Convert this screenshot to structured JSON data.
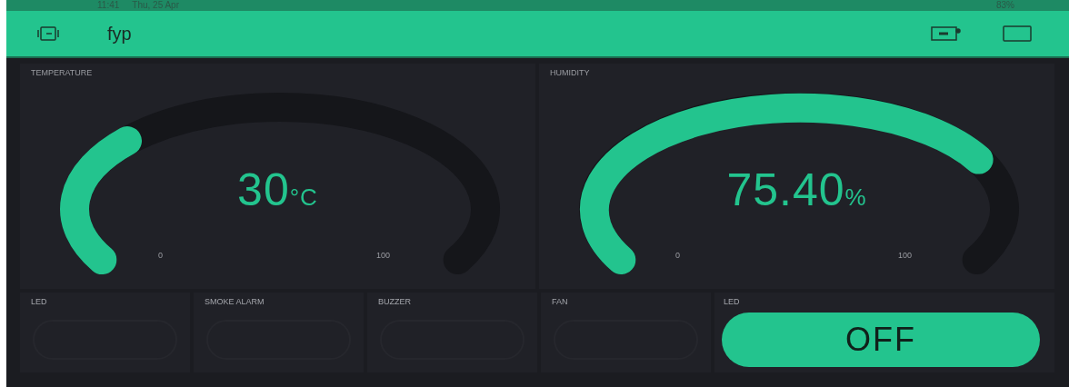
{
  "status_bar": {
    "time": "11:41",
    "date": "Thu, 25 Apr",
    "battery": "83%"
  },
  "app_bar": {
    "title": "fyp"
  },
  "gauges": [
    {
      "label": "TEMPERATURE",
      "value": "30",
      "unit": "°C",
      "min": "0",
      "max": "100"
    },
    {
      "label": "HUMIDITY",
      "value": "75.40",
      "unit": "%",
      "min": "0",
      "max": "100"
    }
  ],
  "switches": [
    {
      "label": "LED",
      "on": false
    },
    {
      "label": "SMOKE ALARM",
      "on": false
    },
    {
      "label": "BUZZER",
      "on": false
    },
    {
      "label": "FAN",
      "on": false
    }
  ],
  "big_button": {
    "label": "LED",
    "text": "OFF",
    "on": false
  }
}
